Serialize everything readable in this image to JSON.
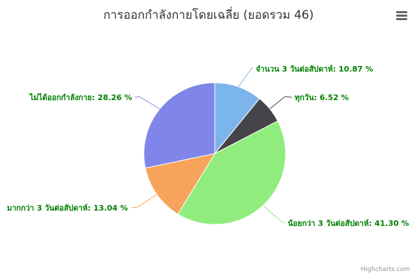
{
  "chart_data": {
    "type": "pie",
    "title": "การออกกำลังกายโดยเฉลี่ย (ยอดรวม 46)",
    "series": [
      {
        "name": "",
        "values": [
          {
            "label": "จำนวน 3 วันต่อสัปดาห์",
            "value": 10.87,
            "display": "จำนวน 3 วันต่อสัปดาห์: 10.87 %",
            "color": "#7cb5ec"
          },
          {
            "label": "ทุกวัน",
            "value": 6.52,
            "display": "ทุกวัน: 6.52 %",
            "color": "#434348"
          },
          {
            "label": "น้อยกว่า 3 วันต่อสัปดาห์",
            "value": 41.3,
            "display": "น้อยกว่า 3 วันต่อสัปดาห์: 41.30 %",
            "color": "#90ed7d"
          },
          {
            "label": "มากกว่า 3 วันต่อสัปดาห์",
            "value": 13.04,
            "display": "มากกว่า 3 วันต่อสัปดาห์: 13.04 %",
            "color": "#f7a35c"
          },
          {
            "label": "ไม่ได้ออกกำลังกาย",
            "value": 28.26,
            "display": "ไม่ได้ออกกำลังกาย: 28.26 %",
            "color": "#8085e9"
          }
        ]
      }
    ],
    "label_color": "#008000"
  },
  "credits": "Highcharts.com",
  "menu_icon": "hamburger-menu-icon"
}
